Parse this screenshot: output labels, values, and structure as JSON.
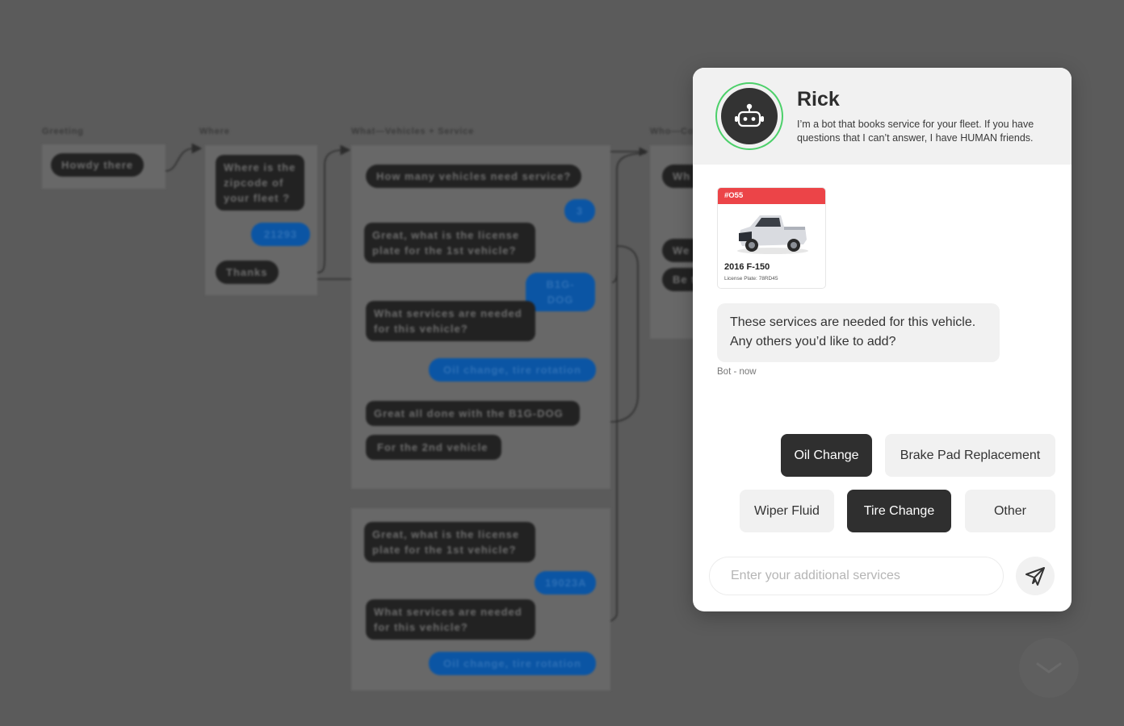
{
  "canvas": {
    "columns": [
      {
        "label": "Greeting"
      },
      {
        "label": "Where"
      },
      {
        "label": "What—Vehicles + Service"
      },
      {
        "label": "Who—Co"
      }
    ],
    "greeting": {
      "bot": "Howdy there"
    },
    "where": {
      "bot_question": "Where is the zipcode of your fleet ?",
      "user_answer": "21293",
      "bot_thanks": "Thanks"
    },
    "what_1": {
      "q_count": "How many vehicles need service?",
      "a_count": "3",
      "q_plate": "Great, what is the license plate for the 1st vehicle?",
      "a_plate": "B1G-DOG",
      "q_services": "What services are needed for this vehicle?",
      "a_services": "Oil change, tire rotation",
      "done": "Great all done with the B1G-DOG",
      "next": "For the 2nd vehicle"
    },
    "what_2": {
      "q_plate": "Great, what is the license plate for the 1st vehicle?",
      "a_plate": "19023A",
      "q_services": "What services are needed for this vehicle?",
      "a_services": "Oil change, tire rotation"
    },
    "who": {
      "b1": "Wh",
      "b2": "We",
      "b3": "Be t"
    }
  },
  "chat": {
    "bot_name": "Rick",
    "bot_description": "I’m a bot that books service for your fleet. If you have questions that I can’t answer, I have HUMAN friends.",
    "vehicle": {
      "tag": "#O55",
      "model": "2016 F-150",
      "plate": "License Plate: 78RD45",
      "tag_color": "#ec4448"
    },
    "message": "These services are needed for this vehicle. Any others you’d like to add?",
    "meta": "Bot - now",
    "options": [
      {
        "label": "Oil Change",
        "selected": true
      },
      {
        "label": "Brake Pad Replacement",
        "selected": false
      },
      {
        "label": "Wiper Fluid",
        "selected": false
      },
      {
        "label": "Tire Change",
        "selected": true
      },
      {
        "label": "Other",
        "selected": false
      }
    ],
    "input": {
      "placeholder": "Enter your additional services",
      "value": ""
    },
    "send_icon": "paper-plane-icon",
    "accent_ring": "#4cd06a"
  },
  "scroll_button_icon": "chevron-down-icon"
}
